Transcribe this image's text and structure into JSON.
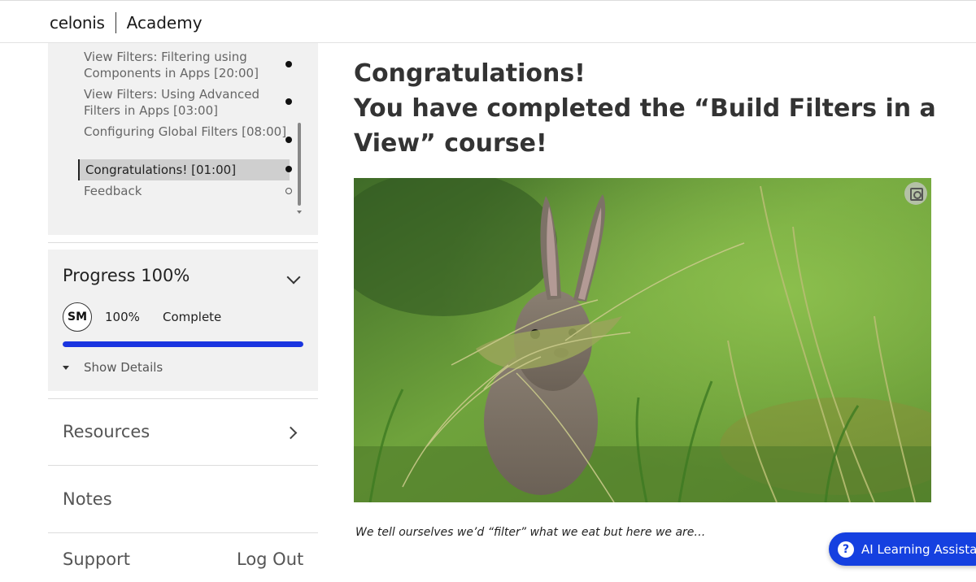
{
  "header": {
    "logo": "celonis",
    "section": "Academy"
  },
  "sidebar": {
    "lessons": [
      {
        "label": "View Filters: Filtering using Components in Apps [20:00]",
        "status": "complete"
      },
      {
        "label": "View Filters: Using Advanced Filters in Apps [03:00]",
        "status": "complete"
      },
      {
        "label": "Configuring Global Filters [08:00]",
        "status": "complete"
      },
      {
        "label": "Congratulations! [01:00]",
        "status": "complete",
        "active": true
      },
      {
        "label": "Feedback",
        "status": "incomplete"
      }
    ],
    "progress": {
      "title": "Progress 100%",
      "avatar_initials": "SM",
      "percent_text": "100%",
      "status": "Complete",
      "fraction": 1.0,
      "show_details": "Show Details"
    },
    "resources_label": "Resources",
    "notes_label": "Notes",
    "support_label": "Support",
    "logout_label": "Log Out"
  },
  "main": {
    "headline_line1": "Congratulations!",
    "headline_line2": "You have completed the “Build Filters in a View” course!",
    "caption": "We tell ourselves we’d “filter” what we eat but here we are…"
  },
  "assistant": {
    "label": "AI Learning Assistant"
  },
  "colors": {
    "accent": "#1a35e0",
    "assistant_bg": "#1540e0",
    "sidebar_bg": "#f1f1f1"
  }
}
